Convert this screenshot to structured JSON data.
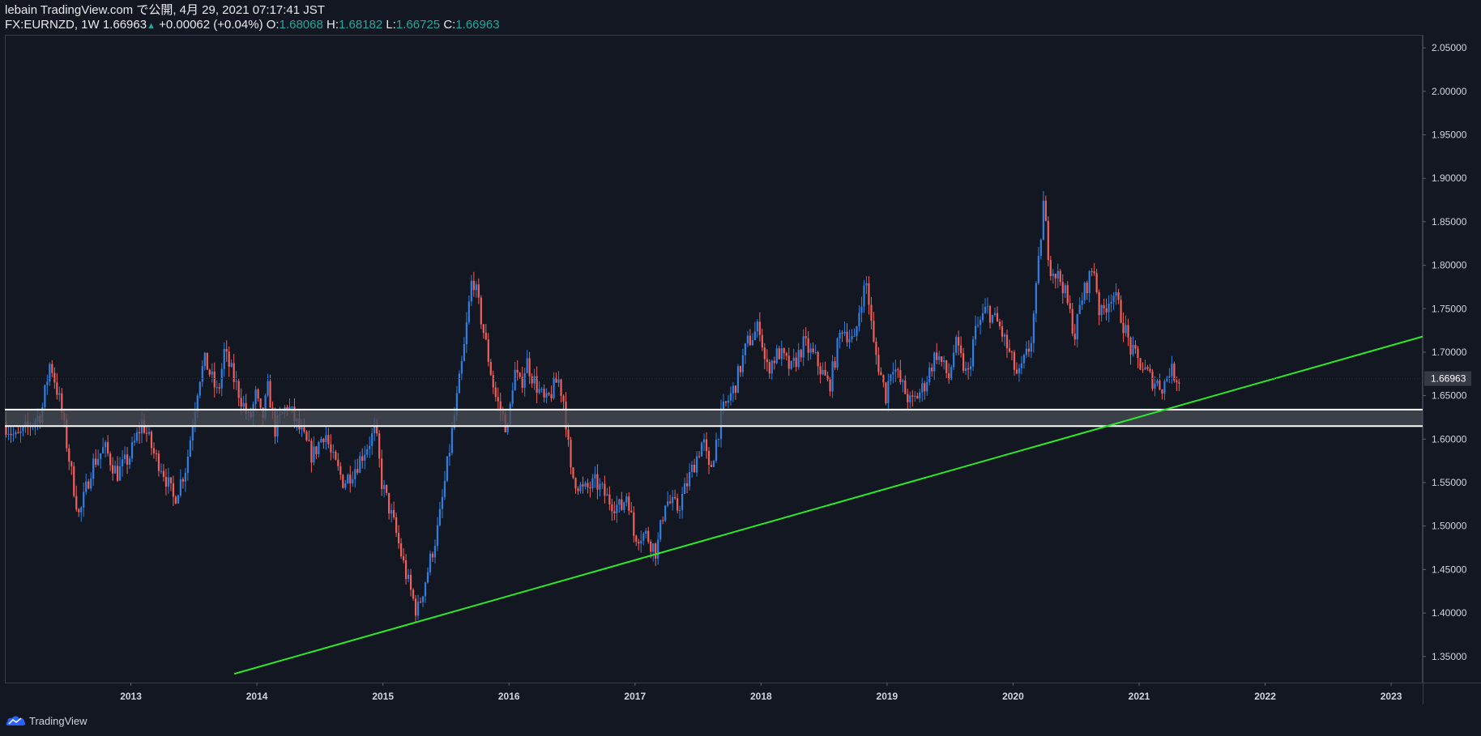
{
  "header": {
    "line1": "lebain TradingView.com で公開, 4月 29, 2021 07:17:41 JST",
    "symbol": "FX:EURNZD, 1W",
    "last": "1.66963",
    "change": "+0.00062 (+0.04%)",
    "o_label": "O:",
    "o": "1.68068",
    "h_label": "H:",
    "h": "1.68182",
    "l_label": "L:",
    "l": "1.66725",
    "c_label": "C:",
    "c": "1.66963"
  },
  "brand": {
    "name": "TradingView"
  },
  "colors": {
    "background": "#131722",
    "up": "#2f7fe0",
    "down": "#f0605a",
    "trendline": "#2ee82a",
    "zone_fill": "#4a4d55",
    "zone_border": "#ffffff",
    "axis_text": "#d1d4dc",
    "price_badge": "#363a45"
  },
  "chart_data": {
    "type": "candlestick",
    "symbol": "FX:EURNZD",
    "interval": "1W",
    "last_price": "1.66963",
    "x_labels": [
      "2013",
      "2014",
      "2015",
      "2016",
      "2017",
      "2018",
      "2019",
      "2020",
      "2021",
      "2022",
      "2023"
    ],
    "y_labels": [
      "2.05000",
      "2.00000",
      "1.95000",
      "1.90000",
      "1.85000",
      "1.80000",
      "1.75000",
      "1.70000",
      "1.65000",
      "1.60000",
      "1.55000",
      "1.50000",
      "1.45000",
      "1.40000",
      "1.35000"
    ],
    "ylim": [
      1.32,
      2.065
    ],
    "xlim": [
      2012.0,
      2023.25
    ],
    "anchors": [
      [
        2012.0,
        1.62
      ],
      [
        2012.1,
        1.6
      ],
      [
        2012.3,
        1.63
      ],
      [
        2012.37,
        1.69
      ],
      [
        2012.45,
        1.64
      ],
      [
        2012.55,
        1.55
      ],
      [
        2012.6,
        1.51
      ],
      [
        2012.7,
        1.57
      ],
      [
        2012.8,
        1.59
      ],
      [
        2012.9,
        1.56
      ],
      [
        2013.0,
        1.58
      ],
      [
        2013.1,
        1.62
      ],
      [
        2013.2,
        1.58
      ],
      [
        2013.25,
        1.57
      ],
      [
        2013.35,
        1.53
      ],
      [
        2013.45,
        1.57
      ],
      [
        2013.55,
        1.67
      ],
      [
        2013.6,
        1.69
      ],
      [
        2013.7,
        1.65
      ],
      [
        2013.75,
        1.7
      ],
      [
        2013.85,
        1.66
      ],
      [
        2013.95,
        1.62
      ],
      [
        2014.0,
        1.65
      ],
      [
        2014.05,
        1.62
      ],
      [
        2014.1,
        1.66
      ],
      [
        2014.15,
        1.61
      ],
      [
        2014.25,
        1.64
      ],
      [
        2014.35,
        1.61
      ],
      [
        2014.45,
        1.58
      ],
      [
        2014.55,
        1.61
      ],
      [
        2014.6,
        1.58
      ],
      [
        2014.7,
        1.55
      ],
      [
        2014.8,
        1.57
      ],
      [
        2014.95,
        1.61
      ],
      [
        2015.0,
        1.55
      ],
      [
        2015.1,
        1.5
      ],
      [
        2015.2,
        1.44
      ],
      [
        2015.28,
        1.4
      ],
      [
        2015.35,
        1.44
      ],
      [
        2015.45,
        1.5
      ],
      [
        2015.55,
        1.6
      ],
      [
        2015.65,
        1.7
      ],
      [
        2015.72,
        1.79
      ],
      [
        2015.8,
        1.73
      ],
      [
        2015.9,
        1.65
      ],
      [
        2016.0,
        1.61
      ],
      [
        2016.05,
        1.68
      ],
      [
        2016.1,
        1.66
      ],
      [
        2016.15,
        1.69
      ],
      [
        2016.2,
        1.67
      ],
      [
        2016.3,
        1.64
      ],
      [
        2016.4,
        1.67
      ],
      [
        2016.45,
        1.64
      ],
      [
        2016.5,
        1.56
      ],
      [
        2016.6,
        1.54
      ],
      [
        2016.7,
        1.55
      ],
      [
        2016.8,
        1.53
      ],
      [
        2016.9,
        1.52
      ],
      [
        2016.95,
        1.54
      ],
      [
        2017.0,
        1.49
      ],
      [
        2017.1,
        1.49
      ],
      [
        2017.18,
        1.47
      ],
      [
        2017.25,
        1.53
      ],
      [
        2017.35,
        1.52
      ],
      [
        2017.45,
        1.56
      ],
      [
        2017.55,
        1.6
      ],
      [
        2017.6,
        1.56
      ],
      [
        2017.7,
        1.63
      ],
      [
        2017.8,
        1.66
      ],
      [
        2017.9,
        1.71
      ],
      [
        2018.0,
        1.73
      ],
      [
        2018.05,
        1.68
      ],
      [
        2018.15,
        1.7
      ],
      [
        2018.25,
        1.68
      ],
      [
        2018.35,
        1.71
      ],
      [
        2018.45,
        1.69
      ],
      [
        2018.55,
        1.66
      ],
      [
        2018.65,
        1.73
      ],
      [
        2018.75,
        1.71
      ],
      [
        2018.8,
        1.76
      ],
      [
        2018.85,
        1.78
      ],
      [
        2018.9,
        1.71
      ],
      [
        2019.0,
        1.65
      ],
      [
        2019.05,
        1.69
      ],
      [
        2019.1,
        1.67
      ],
      [
        2019.2,
        1.64
      ],
      [
        2019.3,
        1.66
      ],
      [
        2019.4,
        1.7
      ],
      [
        2019.5,
        1.67
      ],
      [
        2019.55,
        1.71
      ],
      [
        2019.65,
        1.67
      ],
      [
        2019.7,
        1.72
      ],
      [
        2019.8,
        1.75
      ],
      [
        2019.9,
        1.73
      ],
      [
        2020.0,
        1.69
      ],
      [
        2020.05,
        1.67
      ],
      [
        2020.15,
        1.71
      ],
      [
        2020.2,
        1.78
      ],
      [
        2020.25,
        1.87
      ],
      [
        2020.3,
        1.8
      ],
      [
        2020.4,
        1.78
      ],
      [
        2020.5,
        1.72
      ],
      [
        2020.55,
        1.76
      ],
      [
        2020.65,
        1.8
      ],
      [
        2020.7,
        1.74
      ],
      [
        2020.8,
        1.77
      ],
      [
        2020.85,
        1.75
      ],
      [
        2020.95,
        1.7
      ],
      [
        2021.0,
        1.69
      ],
      [
        2021.1,
        1.67
      ],
      [
        2021.2,
        1.66
      ],
      [
        2021.25,
        1.68
      ],
      [
        2021.32,
        1.67
      ]
    ],
    "annotations": {
      "support_zone": [
        1.615,
        1.634
      ],
      "trendline": [
        [
          2013.82,
          1.33
        ],
        [
          2023.25,
          1.718
        ]
      ]
    }
  }
}
